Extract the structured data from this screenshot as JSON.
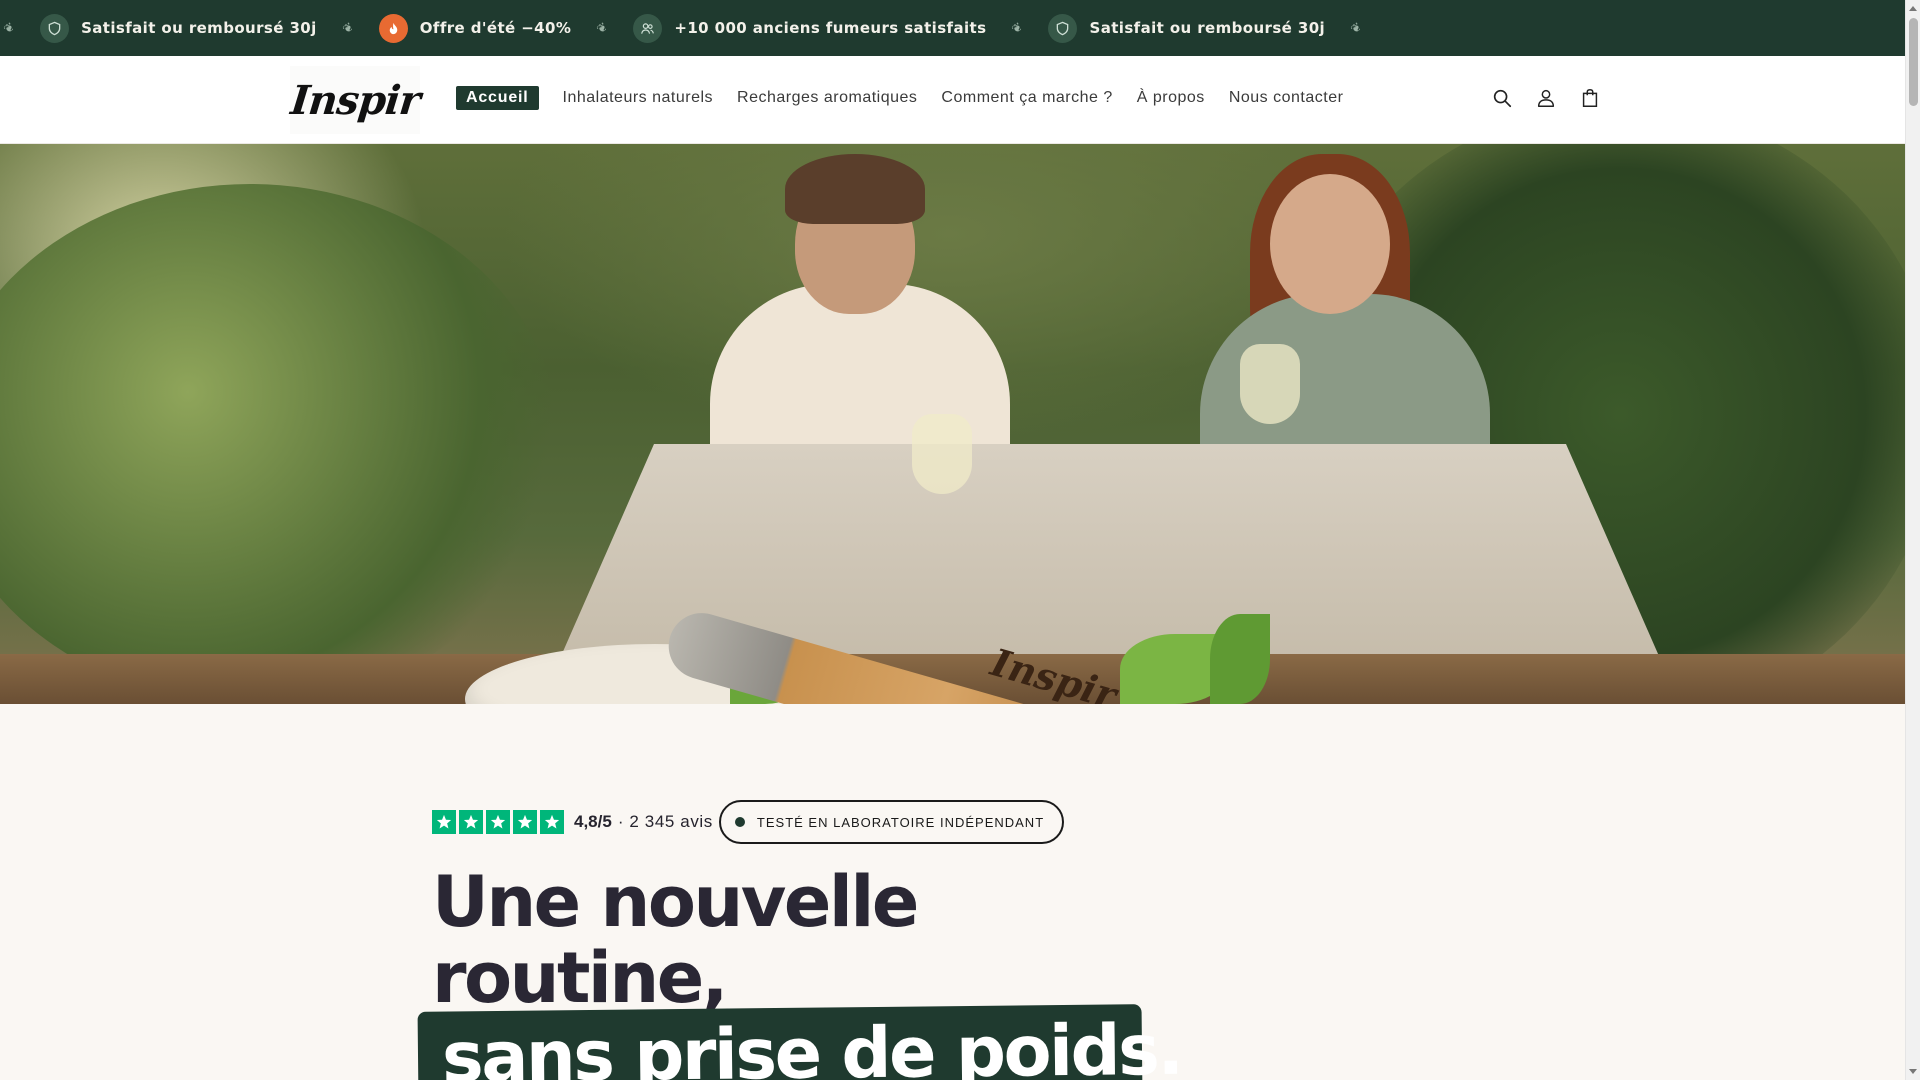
{
  "announcement": {
    "items": [
      {
        "icon": "shield-icon",
        "text": "Satisfait ou remboursé 30j"
      },
      {
        "icon": "flame-icon",
        "text": "Offre d'été −40%"
      },
      {
        "icon": "users-icon",
        "text": "+10 000 anciens fumeurs satisfaits"
      },
      {
        "icon": "shield-icon",
        "text": "Satisfait ou remboursé 30j"
      }
    ],
    "separator_icon": "leaf-icon",
    "background": "#1f3a2f"
  },
  "header": {
    "logo_text": "Inspir",
    "nav": [
      {
        "label": "Accueil",
        "active": true
      },
      {
        "label": "Inhalateurs naturels",
        "active": false
      },
      {
        "label": "Recharges aromatiques",
        "active": false
      },
      {
        "label": "Comment ça marche ?",
        "active": false
      },
      {
        "label": "À propos",
        "active": false
      },
      {
        "label": "Nous contacter",
        "active": false
      }
    ],
    "icons": [
      "search-icon",
      "account-icon",
      "cart-icon"
    ]
  },
  "hero": {
    "product_brand": "Inspir"
  },
  "main": {
    "rating": {
      "stars": 5,
      "score": "4,8/5",
      "reviews": "· 2 345 avis",
      "star_color": "#00b67a"
    },
    "lab_badge": "TESTÉ EN LABORATOIRE INDÉPENDANT",
    "headline_line1": "Une nouvelle",
    "headline_line2": "routine,",
    "headline_highlight": "sans prise de poids."
  },
  "colors": {
    "brand_green": "#1f3a2f",
    "page_bg": "#faf7f3",
    "accent_orange": "#e86a32"
  }
}
